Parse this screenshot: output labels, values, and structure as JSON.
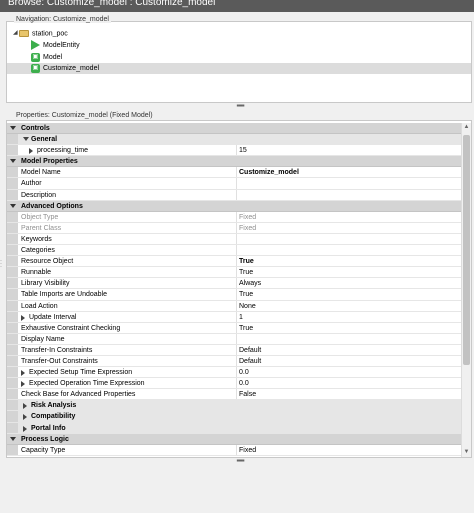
{
  "window": {
    "title": "Browse: Customize_model : Customize_model"
  },
  "navigation": {
    "label": "Navigation: Customize_model",
    "tree": [
      {
        "label": "station_poc",
        "icon": "folder-icon",
        "level": 0,
        "expanded": true
      },
      {
        "label": "ModelEntity",
        "icon": "play-triangle-icon",
        "level": 1
      },
      {
        "label": "Model",
        "icon": "model-cube-icon",
        "level": 1
      },
      {
        "label": "Customize_model",
        "icon": "model-cube-icon",
        "level": 1,
        "selected": true
      }
    ]
  },
  "properties": {
    "label": "Properties: Customize_model (Fixed Model)",
    "rows": [
      {
        "type": "category",
        "name": "Controls"
      },
      {
        "type": "subcategory",
        "name": "General"
      },
      {
        "type": "prop",
        "name": "processing_time",
        "value": "15",
        "indent": 2,
        "expandable": true
      },
      {
        "type": "category",
        "name": "Model Properties"
      },
      {
        "type": "prop",
        "name": "Model Name",
        "value": "Customize_model",
        "bold_value": true
      },
      {
        "type": "prop",
        "name": "Author",
        "value": ""
      },
      {
        "type": "prop",
        "name": "Description",
        "value": ""
      },
      {
        "type": "category",
        "name": "Advanced Options"
      },
      {
        "type": "prop",
        "name": "Object Type",
        "value": "Fixed",
        "disabled": true
      },
      {
        "type": "prop",
        "name": "Parent Class",
        "value": "Fixed",
        "disabled": true
      },
      {
        "type": "prop",
        "name": "Keywords",
        "value": ""
      },
      {
        "type": "prop",
        "name": "Categories",
        "value": ""
      },
      {
        "type": "prop",
        "name": "Resource Object",
        "value": "True",
        "bold_value": true
      },
      {
        "type": "prop",
        "name": "Runnable",
        "value": "True"
      },
      {
        "type": "prop",
        "name": "Library Visibility",
        "value": "Always"
      },
      {
        "type": "prop",
        "name": "Table Imports are Undoable",
        "value": "True"
      },
      {
        "type": "prop",
        "name": "Load Action",
        "value": "None"
      },
      {
        "type": "prop",
        "name": "Update Interval",
        "value": "1",
        "indent": 1,
        "expandable": true
      },
      {
        "type": "prop",
        "name": "Exhaustive Constraint Checking",
        "value": "True"
      },
      {
        "type": "prop",
        "name": "Display Name",
        "value": ""
      },
      {
        "type": "prop",
        "name": "Transfer-In Constraints",
        "value": "Default"
      },
      {
        "type": "prop",
        "name": "Transfer-Out Constraints",
        "value": "Default"
      },
      {
        "type": "prop",
        "name": "Expected Setup Time Expression",
        "value": "0.0",
        "indent": 1,
        "expandable": true
      },
      {
        "type": "prop",
        "name": "Expected Operation Time Expression",
        "value": "0.0",
        "indent": 1,
        "expandable": true
      },
      {
        "type": "prop",
        "name": "Check Base for Advanced Properties",
        "value": "False"
      },
      {
        "type": "subcategory",
        "name": "Risk Analysis",
        "closed": true
      },
      {
        "type": "subcategory",
        "name": "Compatibility",
        "closed": true
      },
      {
        "type": "subcategory",
        "name": "Portal Info",
        "closed": true
      },
      {
        "type": "category",
        "name": "Process Logic"
      },
      {
        "type": "prop",
        "name": "Capacity Type",
        "value": "Fixed"
      }
    ]
  },
  "colors": {
    "title_bar": "#5a5a5a",
    "selected_row": "#dcdcdc",
    "category_bg": "#d4d4d4",
    "model_icon_green": "#3cae4c",
    "folder_yellow": "#e8c56b"
  }
}
